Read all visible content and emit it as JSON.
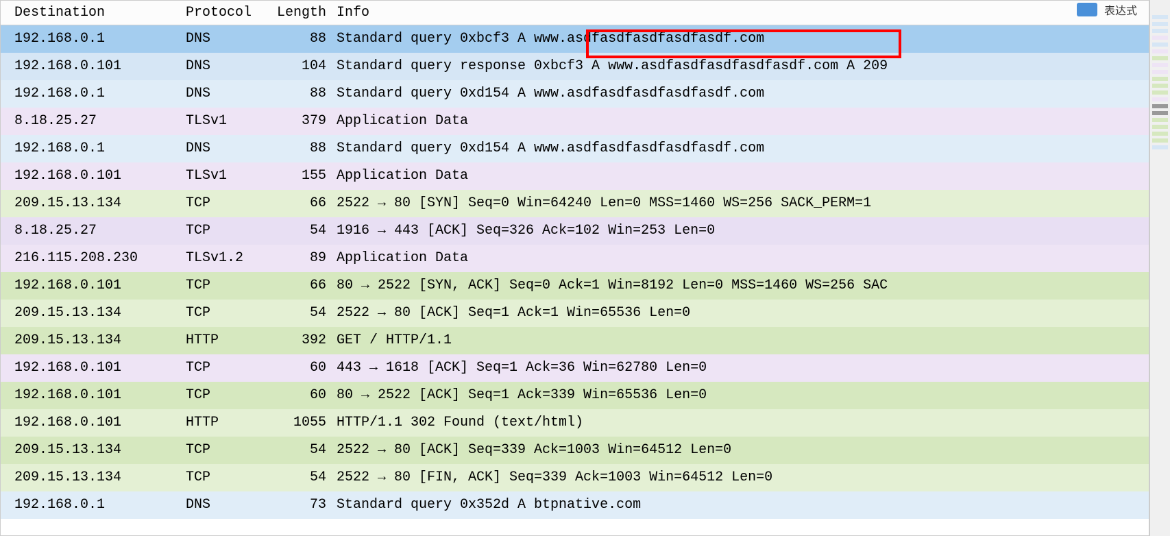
{
  "headers": {
    "destination": "Destination",
    "protocol": "Protocol",
    "length": "Length",
    "info": "Info"
  },
  "top_label": "表达式",
  "rows": [
    {
      "dest": "192.168.0.1",
      "proto": "DNS",
      "len": "88",
      "info": "Standard query 0xbcf3 A www.asdfasdfasdfasdfasdf.com",
      "cls": "row-selected"
    },
    {
      "dest": "192.168.0.101",
      "proto": "DNS",
      "len": "104",
      "info": "Standard query response 0xbcf3 A www.asdfasdfasdfasdfasdf.com A 209",
      "cls": "row-dns"
    },
    {
      "dest": "192.168.0.1",
      "proto": "DNS",
      "len": "88",
      "info": "Standard query 0xd154 A www.asdfasdfasdfasdfasdf.com",
      "cls": "row-dns-alt"
    },
    {
      "dest": "8.18.25.27",
      "proto": "TLSv1",
      "len": "379",
      "info": "Application Data",
      "cls": "row-tls"
    },
    {
      "dest": "192.168.0.1",
      "proto": "DNS",
      "len": "88",
      "info": "Standard query 0xd154 A www.asdfasdfasdfasdfasdf.com",
      "cls": "row-dns-alt"
    },
    {
      "dest": "192.168.0.101",
      "proto": "TLSv1",
      "len": "155",
      "info": "Application Data",
      "cls": "row-tls"
    },
    {
      "dest": "209.15.13.134",
      "proto": "TCP",
      "len": "66",
      "info": "2522 → 80 [SYN] Seq=0 Win=64240 Len=0 MSS=1460 WS=256 SACK_PERM=1",
      "cls": "row-tcp"
    },
    {
      "dest": "8.18.25.27",
      "proto": "TCP",
      "len": "54",
      "info": "1916 → 443 [ACK] Seq=326 Ack=102 Win=253 Len=0",
      "cls": "row-tls-alt"
    },
    {
      "dest": "216.115.208.230",
      "proto": "TLSv1.2",
      "len": "89",
      "info": "Application Data",
      "cls": "row-tls"
    },
    {
      "dest": "192.168.0.101",
      "proto": "TCP",
      "len": "66",
      "info": "80 → 2522 [SYN, ACK] Seq=0 Ack=1 Win=8192 Len=0 MSS=1460 WS=256 SAC",
      "cls": "row-tcp-alt"
    },
    {
      "dest": "209.15.13.134",
      "proto": "TCP",
      "len": "54",
      "info": "2522 → 80 [ACK] Seq=1 Ack=1 Win=65536 Len=0",
      "cls": "row-tcp"
    },
    {
      "dest": "209.15.13.134",
      "proto": "HTTP",
      "len": "392",
      "info": "GET / HTTP/1.1",
      "cls": "row-http-alt"
    },
    {
      "dest": "192.168.0.101",
      "proto": "TCP",
      "len": "60",
      "info": "443 → 1618 [ACK] Seq=1 Ack=36 Win=62780 Len=0",
      "cls": "row-tls"
    },
    {
      "dest": "192.168.0.101",
      "proto": "TCP",
      "len": "60",
      "info": "80 → 2522 [ACK] Seq=1 Ack=339 Win=65536 Len=0",
      "cls": "row-tcp-alt"
    },
    {
      "dest": "192.168.0.101",
      "proto": "HTTP",
      "len": "1055",
      "info": "HTTP/1.1 302 Found  (text/html)",
      "cls": "row-http"
    },
    {
      "dest": "209.15.13.134",
      "proto": "TCP",
      "len": "54",
      "info": "2522 → 80 [ACK] Seq=339 Ack=1003 Win=64512 Len=0",
      "cls": "row-tcp-alt"
    },
    {
      "dest": "209.15.13.134",
      "proto": "TCP",
      "len": "54",
      "info": "2522 → 80 [FIN, ACK] Seq=339 Ack=1003 Win=64512 Len=0",
      "cls": "row-tcp"
    },
    {
      "dest": "192.168.0.1",
      "proto": "DNS",
      "len": "73",
      "info": "Standard query 0x352d A btpnative.com",
      "cls": "row-dns-alt"
    }
  ]
}
